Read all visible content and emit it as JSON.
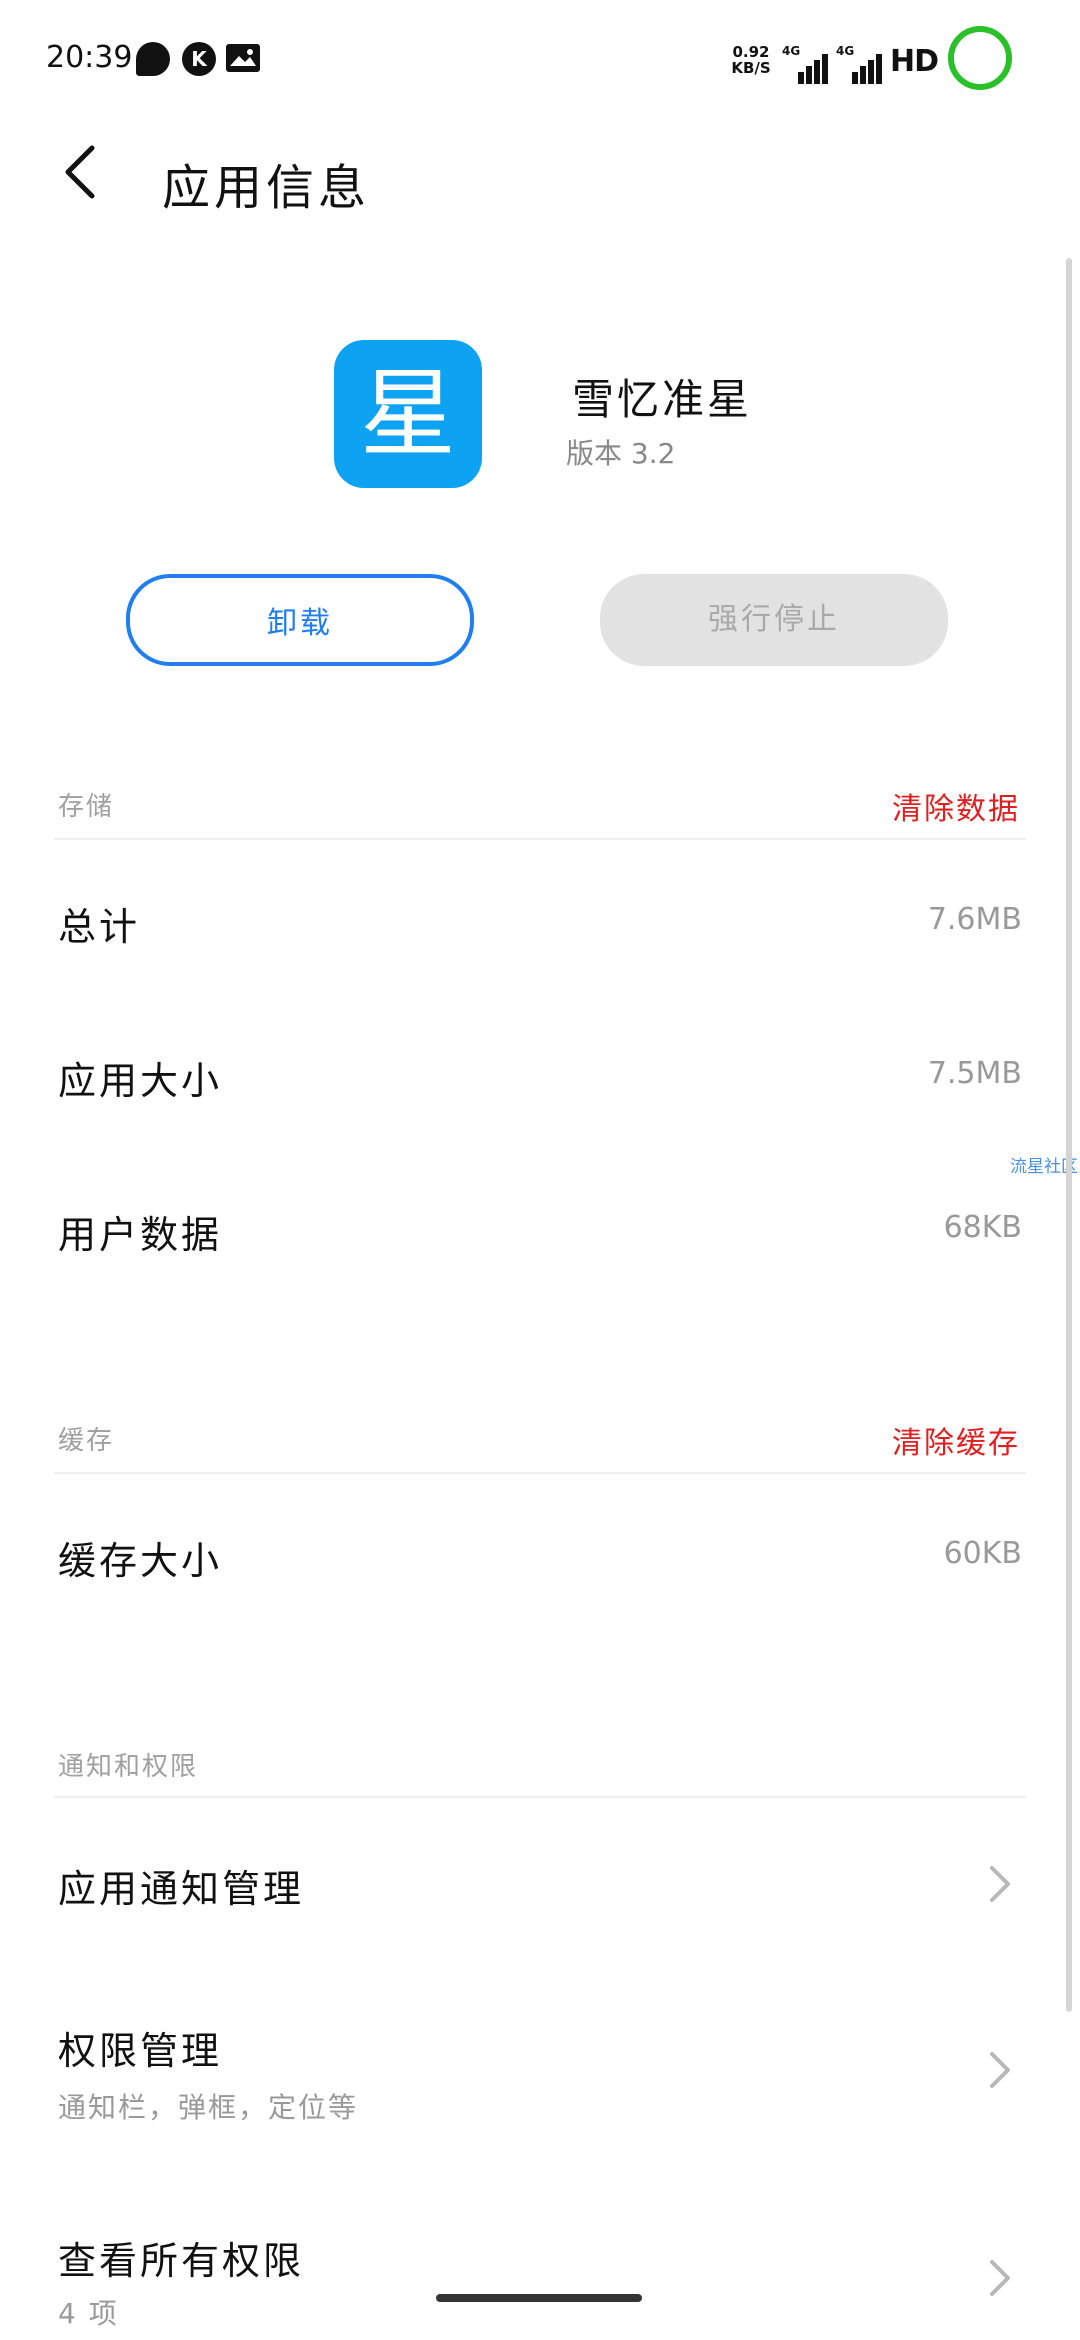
{
  "status_bar": {
    "time": "20:39",
    "icons": [
      "chat-bubble-icon",
      "k-app-icon",
      "image-icon"
    ],
    "k_label": "K",
    "net_speed_value": "0.92",
    "net_speed_unit": "KB/S",
    "signal1_tag": "4G",
    "signal2_tag": "4G",
    "hd_label": "HD",
    "battery_color": "#2ac02a"
  },
  "header": {
    "title": "应用信息"
  },
  "app": {
    "icon_char": "星",
    "icon_color": "#0ea2f2",
    "name": "雪忆准星",
    "version": "版本 3.2"
  },
  "buttons": {
    "uninstall": "卸载",
    "force_stop": "强行停止"
  },
  "storage": {
    "label": "存储",
    "clear_action": "清除数据",
    "rows": [
      {
        "label": "总计",
        "value": "7.6MB"
      },
      {
        "label": "应用大小",
        "value": "7.5MB"
      },
      {
        "label": "用户数据",
        "value": "68KB"
      }
    ]
  },
  "cache": {
    "label": "缓存",
    "clear_action": "清除缓存",
    "rows": [
      {
        "label": "缓存大小",
        "value": "60KB"
      }
    ]
  },
  "permissions": {
    "label": "通知和权限",
    "rows": [
      {
        "label": "应用通知管理",
        "sub": ""
      },
      {
        "label": "权限管理",
        "sub": "通知栏，弹框，定位等"
      },
      {
        "label": "查看所有权限",
        "sub": "4 项"
      }
    ]
  },
  "watermark": "流星社区",
  "colors": {
    "accent_blue": "#1f7ff0",
    "danger_red": "#e02020"
  }
}
